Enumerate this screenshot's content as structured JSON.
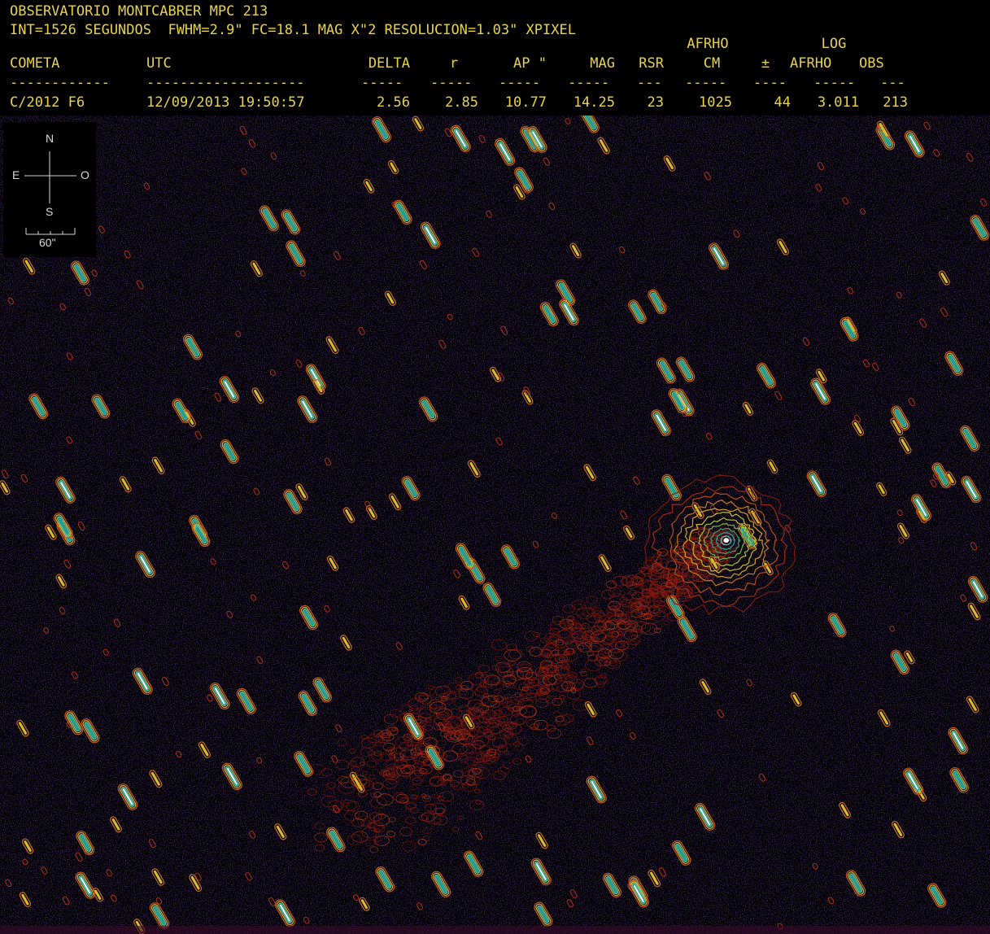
{
  "header": {
    "line1": "OBSERVATORIO MONTCABRER MPC 213",
    "line2": "INT=1526 SEGUNDOS  FWHM=2.9\" FC=18.1 MAG X\"2 RESOLUCION=1.03\" XPIXEL",
    "top_labels": {
      "afrho": "AFRHO",
      "log": "LOG"
    },
    "columns": [
      "COMETA",
      "UTC",
      "DELTA",
      "r",
      "AP \"",
      "MAG",
      "RSR",
      "CM",
      "±",
      "AFRHO",
      "OBS"
    ],
    "dashes": [
      "------------",
      "-------------------",
      "-----",
      "-----",
      "-----",
      "-----",
      "---",
      "-----",
      "----",
      "-----",
      "---"
    ],
    "row": [
      "C/2012 F6",
      "12/09/2013 19:50:57",
      "2.56",
      "2.85",
      "10.77",
      "14.25",
      "23",
      "1025",
      "44",
      "3.011",
      "213"
    ]
  },
  "compass": {
    "north": "N",
    "south": "S",
    "east": "E",
    "west": "O",
    "scale": "60\""
  },
  "colors": {
    "text": "#e8d24a",
    "background": "#000000",
    "noise": "#2a1060"
  }
}
